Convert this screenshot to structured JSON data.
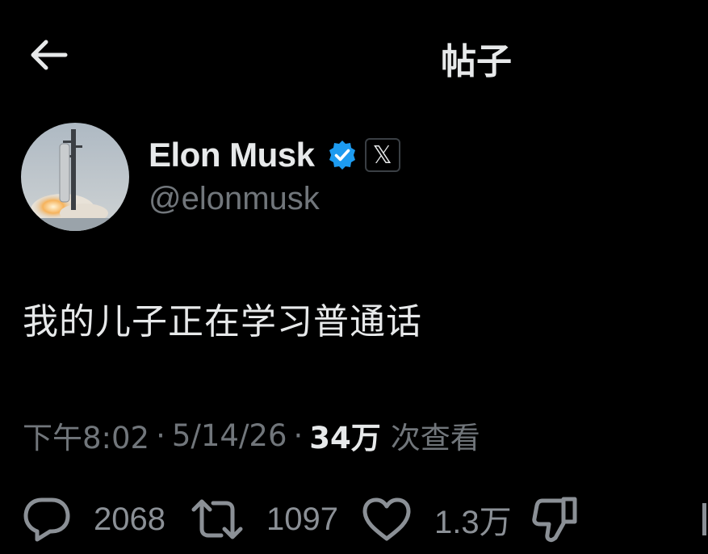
{
  "header": {
    "title": "帖子"
  },
  "author": {
    "name": "Elon Musk",
    "handle": "@elonmusk",
    "affiliate_badge": "𝕏",
    "verified_color": "#1d9bf0"
  },
  "tweet": {
    "text": "我的儿子正在学习普通话",
    "time": "下午8:02",
    "separator": "·",
    "date": "5/14/26",
    "views_count": "34万",
    "views_label": "次查看"
  },
  "actions": {
    "replies": "2068",
    "retweets": "1097",
    "likes": "1.3万"
  },
  "icons": {
    "back": "arrow-left-icon",
    "verified": "verified-badge-icon",
    "reply": "reply-bubble-icon",
    "retweet": "retweet-icon",
    "like": "heart-icon",
    "dislike": "thumbs-down-icon"
  },
  "colors": {
    "background": "#000000",
    "text_primary": "#e7e9ea",
    "text_secondary": "#71767b",
    "accent": "#1d9bf0"
  }
}
